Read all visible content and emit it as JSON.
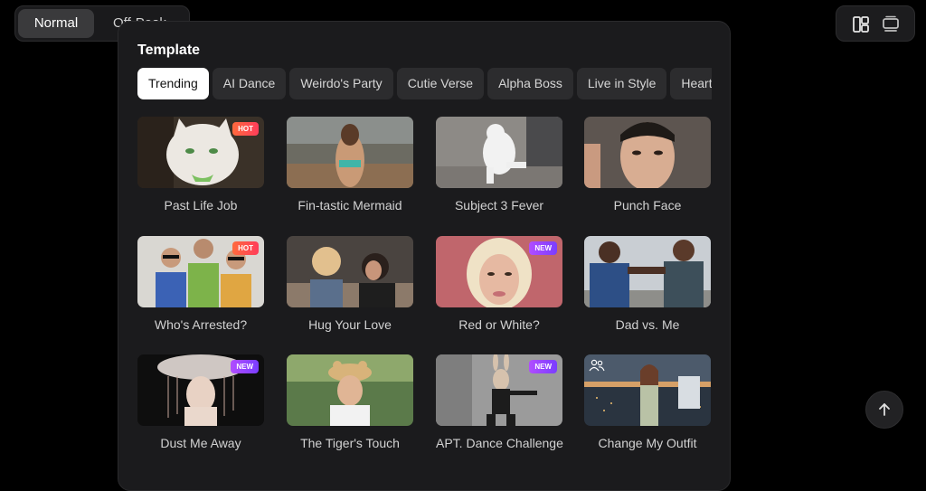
{
  "mode_toggle": {
    "active": "Normal",
    "inactive": "Off-Peak"
  },
  "view_switch": {
    "grid_icon": "layout-grid-icon",
    "list_icon": "layout-list-icon"
  },
  "panel": {
    "title": "Template"
  },
  "tabs": [
    {
      "label": "Trending",
      "active": true
    },
    {
      "label": "AI Dance",
      "active": false
    },
    {
      "label": "Weirdo's Party",
      "active": false
    },
    {
      "label": "Cutie Verse",
      "active": false
    },
    {
      "label": "Alpha Boss",
      "active": false
    },
    {
      "label": "Live in Style",
      "active": false
    },
    {
      "label": "Heart Eyes",
      "active": false
    }
  ],
  "templates": [
    {
      "title": "Past Life Job",
      "badge": "HOT",
      "image": "white-cat-photo"
    },
    {
      "title": "Fin-tastic Mermaid",
      "badge": "",
      "image": "woman-beach-photo"
    },
    {
      "title": "Subject 3 Fever",
      "badge": "",
      "image": "dancing-dog-photo"
    },
    {
      "title": "Punch Face",
      "badge": "",
      "image": "man-portrait-photo"
    },
    {
      "title": "Who's Arrested?",
      "badge": "HOT",
      "image": "group-sunglasses-photo"
    },
    {
      "title": "Hug Your Love",
      "badge": "",
      "image": "two-women-photo"
    },
    {
      "title": "Red or White?",
      "badge": "NEW",
      "image": "blonde-woman-photo"
    },
    {
      "title": "Dad vs. Me",
      "badge": "",
      "image": "two-men-fighting-photo"
    },
    {
      "title": "Dust Me Away",
      "badge": "NEW",
      "image": "cloud-figure-photo"
    },
    {
      "title": "The Tiger's Touch",
      "badge": "",
      "image": "woman-tiger-hat-photo"
    },
    {
      "title": "APT. Dance Challenge",
      "badge": "NEW",
      "image": "dancing-rabbit-photo"
    },
    {
      "title": "Change My Outfit",
      "badge": "",
      "image": "woman-city-night-photo"
    }
  ],
  "scroll_top_icon": "arrow-up-icon"
}
